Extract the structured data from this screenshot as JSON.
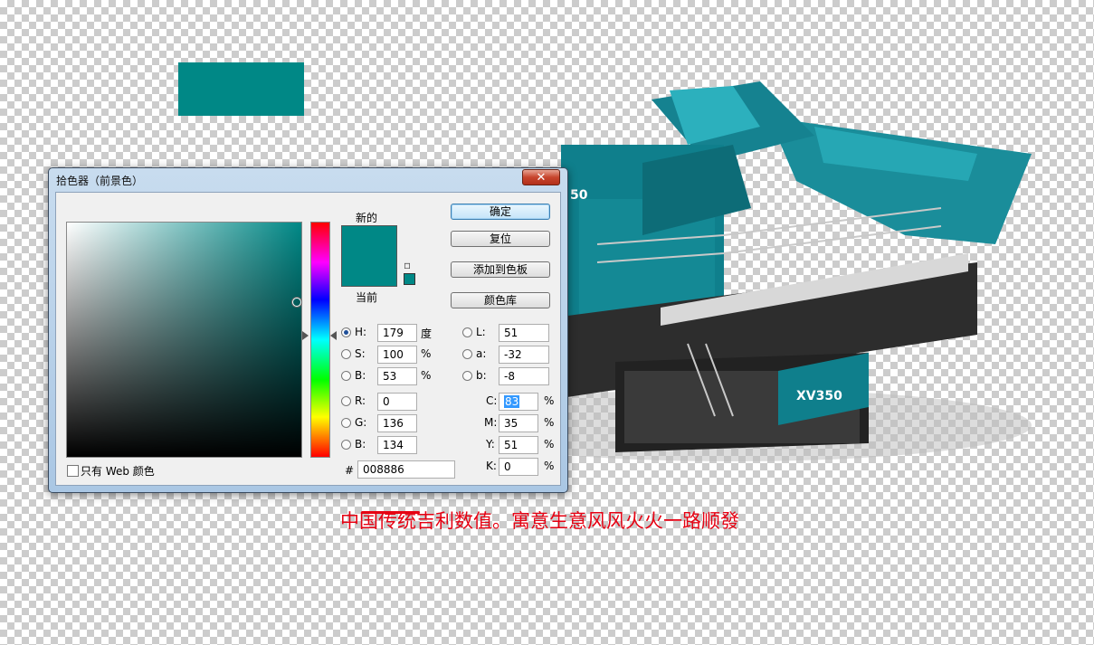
{
  "colors": {
    "current": "#008886",
    "caption": "#e60012",
    "accent": "#3399ff"
  },
  "dialog": {
    "title": "拾色器（前景色）",
    "close_glyph": "✕",
    "new_label": "新的",
    "current_label": "当前",
    "buttons": {
      "ok": "确定",
      "reset": "复位",
      "add_swatch": "添加到色板",
      "color_libraries": "颜色库"
    },
    "fields": {
      "H": {
        "label": "H:",
        "value": "179",
        "unit": "度"
      },
      "S": {
        "label": "S:",
        "value": "100",
        "unit": "%"
      },
      "Bv": {
        "label": "B:",
        "value": "53",
        "unit": "%"
      },
      "R": {
        "label": "R:",
        "value": "0"
      },
      "G": {
        "label": "G:",
        "value": "136"
      },
      "Bb": {
        "label": "B:",
        "value": "134"
      },
      "L": {
        "label": "L:",
        "value": "51"
      },
      "a": {
        "label": "a:",
        "value": "-32"
      },
      "b": {
        "label": "b:",
        "value": "-8"
      },
      "C": {
        "label": "C:",
        "value": "83",
        "unit": "%"
      },
      "M": {
        "label": "M:",
        "value": "35",
        "unit": "%"
      },
      "Y": {
        "label": "Y:",
        "value": "51",
        "unit": "%"
      },
      "K": {
        "label": "K:",
        "value": "0",
        "unit": "%"
      }
    },
    "hex": {
      "label": "#",
      "value": "008886"
    },
    "web_only_label": "只有 Web 颜色"
  },
  "machine": {
    "side_label": "XV350",
    "front_label": "50"
  },
  "caption": "中国传统吉利数值。寓意生意风风火火一路顺發"
}
